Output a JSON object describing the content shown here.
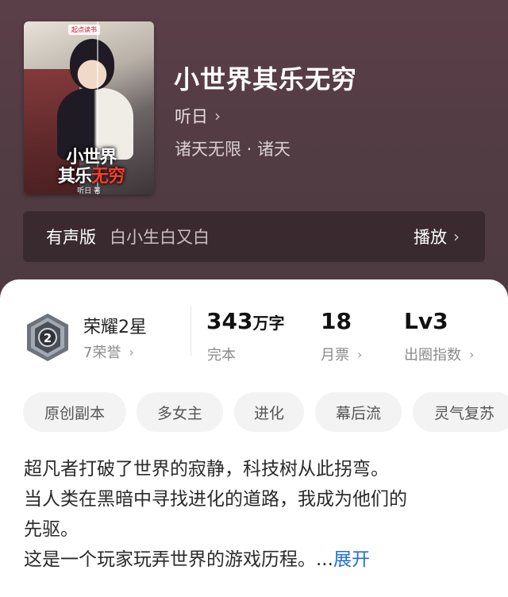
{
  "book": {
    "title": "小世界其乐无穷",
    "author": "听日",
    "genre": "诸天无限 · 诸天",
    "cover": {
      "publisher_logo": "起点读书",
      "title_line1": "小世界",
      "title_line2a": "其乐",
      "title_line2b": "无穷",
      "author": "听日 著"
    }
  },
  "audio": {
    "label": "有声版",
    "narrator": "白小生白又白",
    "play_label": "播放"
  },
  "stats": {
    "honor": {
      "title": "荣耀2星",
      "sub": "7荣誉",
      "badge_level": "2"
    },
    "words": {
      "value": "343",
      "unit": "万字",
      "sub": "完本"
    },
    "tickets": {
      "value": "18",
      "sub": "月票"
    },
    "level": {
      "value": "Lv3",
      "sub": "出圈指数"
    }
  },
  "tags": [
    "原创副本",
    "多女主",
    "进化",
    "幕后流",
    "灵气复苏"
  ],
  "description": {
    "line1": "超凡者打破了世界的寂静，科技树从此拐弯。",
    "line2": "当人类在黑暗中寻找进化的道路，我成为他们的",
    "line3": "先驱。",
    "line4": "这是一个玩家玩弄世界的游戏历程。...",
    "expand_label": "展开"
  },
  "colors": {
    "header_bg": "#533c44",
    "link_blue": "#1f6fd6",
    "tag_bg": "#f3f3f3"
  },
  "icons": {
    "chevron": "chevron-right-icon",
    "badge": "honor-badge-icon"
  }
}
